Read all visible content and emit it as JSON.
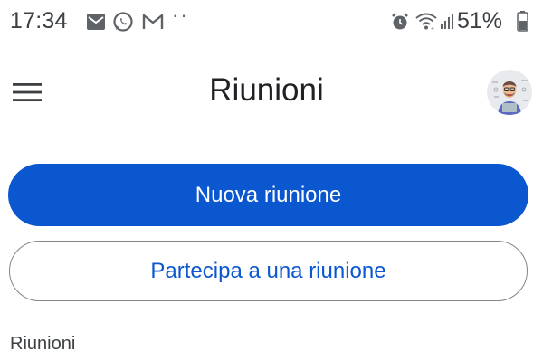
{
  "status_bar": {
    "time": "17:34",
    "dots": "··",
    "battery_percent": "51%",
    "icons": [
      "mail-icon",
      "whatsapp-icon",
      "gmail-icon",
      "alarm-icon",
      "wifi-icon",
      "signal-icon",
      "battery-icon"
    ]
  },
  "app_bar": {
    "title": "Riunioni",
    "menu_icon": "hamburger-menu-icon",
    "avatar_icon": "user-avatar"
  },
  "actions": {
    "new_meeting_label": "Nuova riunione",
    "join_meeting_label": "Partecipa a una riunione"
  },
  "section": {
    "heading": "Riunioni"
  },
  "colors": {
    "primary": "#0b57d0",
    "outline": "#80868b",
    "text": "#202124",
    "background": "#ffffff"
  }
}
